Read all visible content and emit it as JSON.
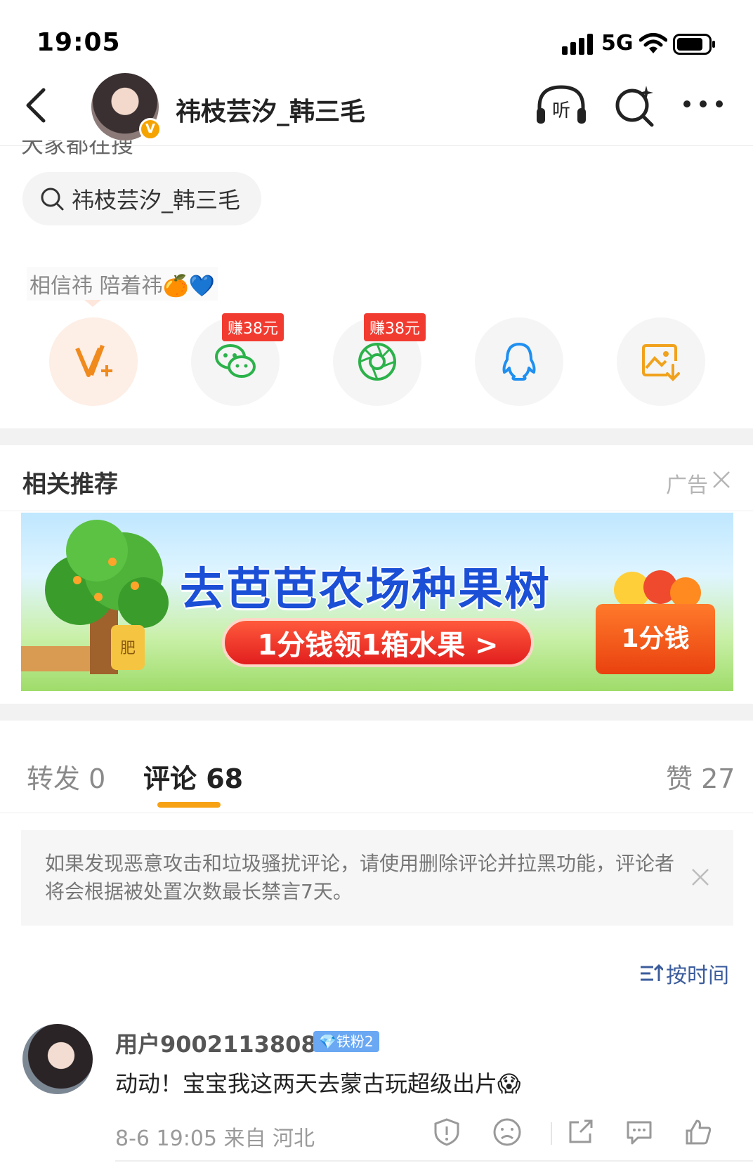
{
  "status_bar": {
    "time": "19:05",
    "network": "5G"
  },
  "nav": {
    "title": "祎枝芸汐_韩三毛",
    "verify_badge": "V"
  },
  "search_section": {
    "cut_label": "大家都在搜",
    "chip_text": "祎枝芸汐_韩三毛"
  },
  "share": {
    "caption": "相信祎 陪着祎🍊💙",
    "items": [
      {
        "name": "vip-share",
        "badge": ""
      },
      {
        "name": "wechat",
        "badge": "赚38元"
      },
      {
        "name": "moments",
        "badge": "赚38元"
      },
      {
        "name": "qq",
        "badge": ""
      },
      {
        "name": "save-image",
        "badge": ""
      }
    ]
  },
  "recommend": {
    "title": "相关推荐",
    "ad_label": "广告"
  },
  "ad": {
    "headline": "去芭芭农场种果树",
    "cta": "1分钱领1箱水果 >",
    "box_text": "1分钱",
    "fertilizer": "肥"
  },
  "tabs": {
    "repost": "转发 0",
    "comment": "评论 68",
    "like": "赞 27"
  },
  "notice": {
    "text": "如果发现恶意攻击和垃圾骚扰评论，请使用删除评论并拉黑功能，评论者将会根据被处置次数最长禁言7天。"
  },
  "sort": {
    "label": "按时间"
  },
  "comment": {
    "user": "用户9002113808",
    "badge": "💎铁粉2",
    "text": "动动！宝宝我这两天去蒙古玩超级出片😱",
    "meta": "8-6 19:05  来自 河北"
  },
  "colors": {
    "accent": "#f7a215",
    "link": "#3b5c9c",
    "ad_red": "#f23b30"
  }
}
